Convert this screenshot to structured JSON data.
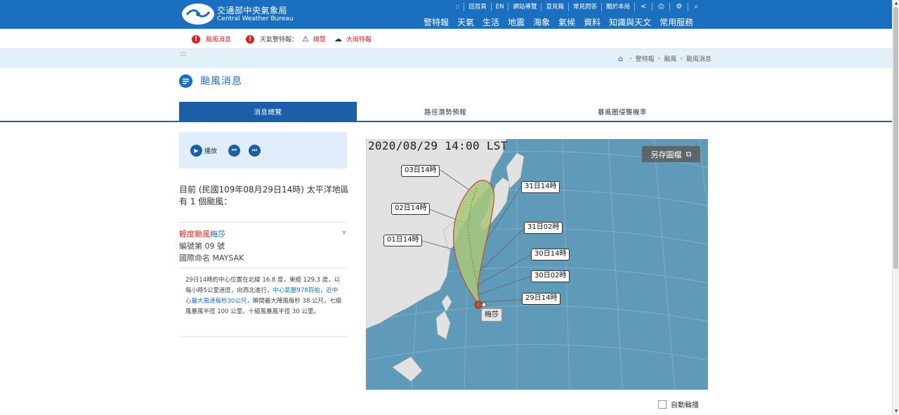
{
  "header": {
    "logo_zh": "交通部中央氣象局",
    "logo_en": "Central Weather Bureau",
    "topnav": [
      {
        "label": "::",
        "icon": ""
      },
      {
        "label": "回首頁",
        "icon": ""
      },
      {
        "label": "EN",
        "icon": ""
      },
      {
        "label": "網站導覽",
        "icon": ""
      },
      {
        "label": "意見箱",
        "icon": ""
      },
      {
        "label": "常見問答",
        "icon": ""
      },
      {
        "label": "關於本局",
        "icon": ""
      },
      {
        "label": "",
        "icon": "share-icon"
      },
      {
        "label": "",
        "icon": "print-icon"
      },
      {
        "label": "",
        "icon": "settings-icon"
      },
      {
        "label": "",
        "icon": "search-icon"
      }
    ],
    "mainnav": [
      "警特報",
      "天氣",
      "生活",
      "地震",
      "海象",
      "氣候",
      "資料",
      "知識與天文",
      "常用服務"
    ]
  },
  "alerts": {
    "typhoon": "颱風消息",
    "weather_label": "天氣警特報：",
    "overview": "總覽",
    "heavy_rain": "大雨特報"
  },
  "breadcrumb": {
    "dots": ":::",
    "items": [
      "警特報",
      "颱風",
      "颱風消息"
    ]
  },
  "page_title": "颱風消息",
  "tabs": [
    "消息總覽",
    "路徑潛勢預報",
    "暴風圈侵襲機率"
  ],
  "player": {
    "play_label": "播放"
  },
  "summary": "目前 (民國109年08月29日14時) 太平洋地區有 1 個颱風：",
  "storm": {
    "category": "輕度颱風",
    "name": "梅莎",
    "number": "編號第 09 號",
    "intl_name": "國際命名 MAYSAK"
  },
  "detail": {
    "part1": "29日14時的中心位置在北緯 16.8 度，東經 129.3 度，以每小時5公里速度，向西北進行，",
    "pressure": "中心氣壓978百帕",
    "comma": "，",
    "wind": "近中心最大風速每秒30公尺",
    "part2": "，瞬間最大陣風每秒 38 公尺，七級風暴風半徑 100 公里，十級風暴風半徑 30 公里。"
  },
  "map": {
    "timestamp": "2020/08/29 14:00 LST",
    "save_label": "另存圖檔",
    "storm_tag": "梅莎",
    "time_labels": [
      "03日14時",
      "02日14時",
      "01日14時",
      "31日14時",
      "31日02時",
      "30日14時",
      "30日02時",
      "29日14時"
    ],
    "colors": {
      "ocean": "#5f9ab8",
      "land": "#e2e2e2",
      "cone_fill": "#a8c878",
      "cone_edge": "#c0503a",
      "storm_center": "#d94a1e"
    }
  },
  "auto_play_label": "自動輪播"
}
